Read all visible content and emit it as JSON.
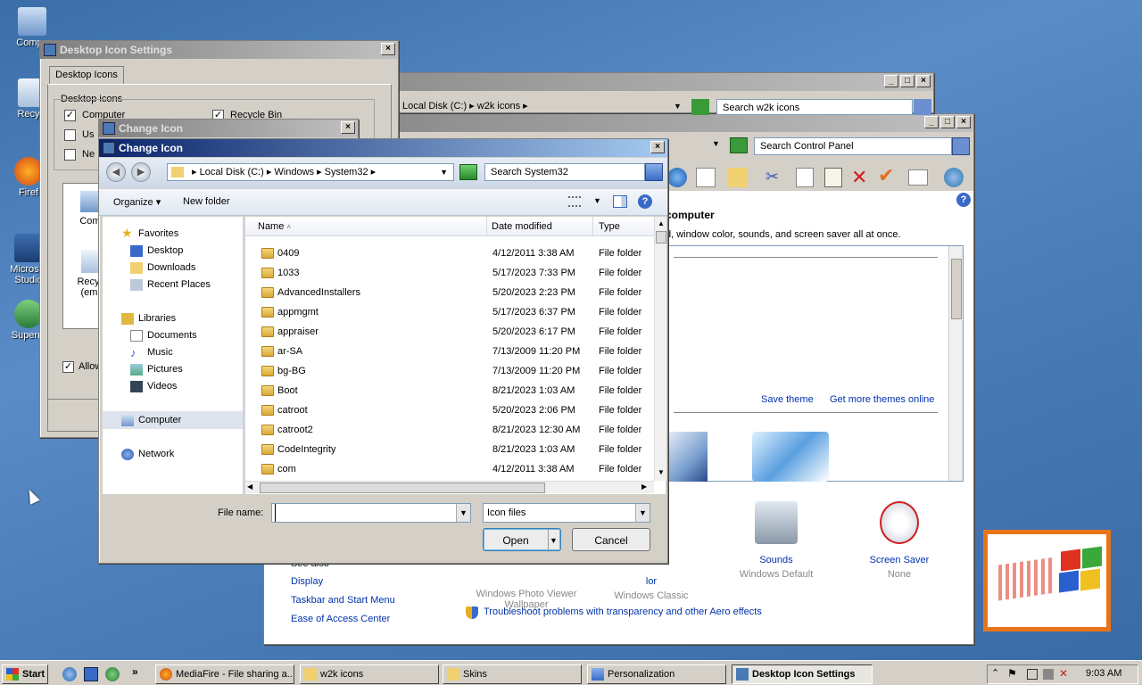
{
  "desktop": {
    "icons": [
      {
        "label": "Compu"
      },
      {
        "label": "Recycl"
      },
      {
        "label": "Firef"
      },
      {
        "label": "Microsof Studio"
      },
      {
        "label": "Superm"
      }
    ]
  },
  "icon_settings": {
    "title": "Desktop Icon Settings",
    "tab": "Desktop Icons",
    "group_label": "Desktop icons",
    "checks": [
      {
        "label": "Computer",
        "checked": true
      },
      {
        "label": "Recycle Bin",
        "checked": true
      },
      {
        "label": "Us",
        "checked": false
      },
      {
        "label": "Ne",
        "checked": false
      }
    ],
    "previews": [
      "Comp",
      "Recycl (emp"
    ],
    "allow_label": "Allow"
  },
  "explorer_w2k": {
    "breadcrumb": [
      "Local Disk (C:)",
      "w2k icons"
    ],
    "search_placeholder": "Search w2k icons"
  },
  "control_panel": {
    "search_placeholder": "Search Control Panel",
    "heading": "computer",
    "subtext": "d, window color, sounds, and screen saver all at once.",
    "save_theme": "Save theme",
    "more_themes": "Get more themes online",
    "see_also": "See also",
    "see_also_links": [
      "Display",
      "Taskbar and Start Menu",
      "Ease of Access Center"
    ],
    "items": [
      {
        "title": "Windows Photo Viewer",
        "sub": "Wallpaper"
      },
      {
        "title": "lor",
        "sub": "Windows Classic"
      },
      {
        "title": "Sounds",
        "sub": "Windows Default"
      },
      {
        "title": "Screen Saver",
        "sub": "None"
      }
    ],
    "troubleshoot": "Troubleshoot problems with transparency and other Aero effects"
  },
  "change_icon_small": {
    "title": "Change Icon"
  },
  "change_icon": {
    "title": "Change Icon",
    "breadcrumb": [
      "Local Disk (C:)",
      "Windows",
      "System32"
    ],
    "search_placeholder": "Search System32",
    "organize": "Organize",
    "new_folder": "New folder",
    "columns": {
      "name": "Name",
      "date": "Date modified",
      "type": "Type"
    },
    "nav": {
      "favorites": "Favorites",
      "fav_items": [
        "Desktop",
        "Downloads",
        "Recent Places"
      ],
      "libraries": "Libraries",
      "lib_items": [
        "Documents",
        "Music",
        "Pictures",
        "Videos"
      ],
      "computer": "Computer",
      "network": "Network"
    },
    "files": [
      {
        "name": "0409",
        "date": "4/12/2011 3:38 AM",
        "type": "File folder"
      },
      {
        "name": "1033",
        "date": "5/17/2023 7:33 PM",
        "type": "File folder"
      },
      {
        "name": "AdvancedInstallers",
        "date": "5/20/2023 2:23 PM",
        "type": "File folder"
      },
      {
        "name": "appmgmt",
        "date": "5/17/2023 6:37 PM",
        "type": "File folder"
      },
      {
        "name": "appraiser",
        "date": "5/20/2023 6:17 PM",
        "type": "File folder"
      },
      {
        "name": "ar-SA",
        "date": "7/13/2009 11:20 PM",
        "type": "File folder"
      },
      {
        "name": "bg-BG",
        "date": "7/13/2009 11:20 PM",
        "type": "File folder"
      },
      {
        "name": "Boot",
        "date": "8/21/2023 1:03 AM",
        "type": "File folder"
      },
      {
        "name": "catroot",
        "date": "5/20/2023 2:06 PM",
        "type": "File folder"
      },
      {
        "name": "catroot2",
        "date": "8/21/2023 12:30 AM",
        "type": "File folder"
      },
      {
        "name": "CodeIntegrity",
        "date": "8/21/2023 1:03 AM",
        "type": "File folder"
      },
      {
        "name": "com",
        "date": "4/12/2011 3:38 AM",
        "type": "File folder"
      }
    ],
    "filename_label": "File name:",
    "filename_value": "",
    "filetype_value": "Icon files",
    "open": "Open",
    "cancel": "Cancel"
  },
  "taskbar": {
    "start": "Start",
    "tasks": [
      {
        "label": "MediaFire - File sharing a..."
      },
      {
        "label": "w2k icons"
      },
      {
        "label": "Skins"
      },
      {
        "label": "Personalization"
      },
      {
        "label": "Desktop Icon Settings"
      }
    ],
    "clock": "9:03 AM"
  },
  "colors": {
    "accent": "#0a246a",
    "desktop": "#4a7cb8"
  }
}
